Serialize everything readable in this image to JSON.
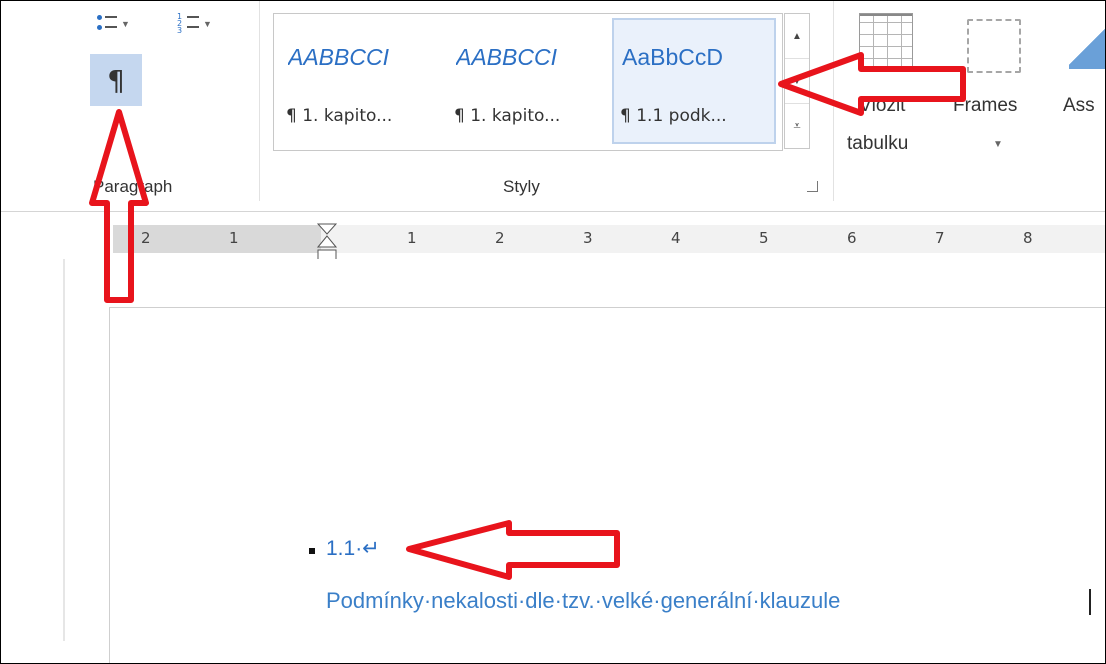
{
  "ribbon": {
    "paragraph_group_label": "Paragraph",
    "show_marks_glyph": "¶",
    "styles_group_label": "Styly",
    "styles": [
      {
        "preview": "AABBCCI",
        "name": "¶ 1. kapito..."
      },
      {
        "preview": "AABBCCI",
        "name": "¶ 1. kapito..."
      },
      {
        "preview": "AaBbCcD",
        "name": "¶ 1.1 podk..."
      }
    ],
    "insert_table_label_1": "Vložit",
    "insert_table_label_2": "tabulku",
    "frames_label": "Frames",
    "ass_label": "Ass"
  },
  "ruler": {
    "labels": [
      "2",
      "1",
      "1",
      "2",
      "3",
      "4",
      "5",
      "6",
      "7",
      "8"
    ]
  },
  "document": {
    "heading_number": "1.1·↵",
    "heading_text": "Podmínky·nekalosti·dle·tzv.·velké·generální·klauzule"
  },
  "colors": {
    "accent": "#2b6fc4",
    "annotation": "#e8141c",
    "selected_style_bg": "#eaf1fb"
  },
  "icons": [
    "bullet-list-icon",
    "numbered-list-icon",
    "pilcrow-icon",
    "insert-table-icon",
    "frames-icon",
    "dialog-launcher-icon"
  ]
}
